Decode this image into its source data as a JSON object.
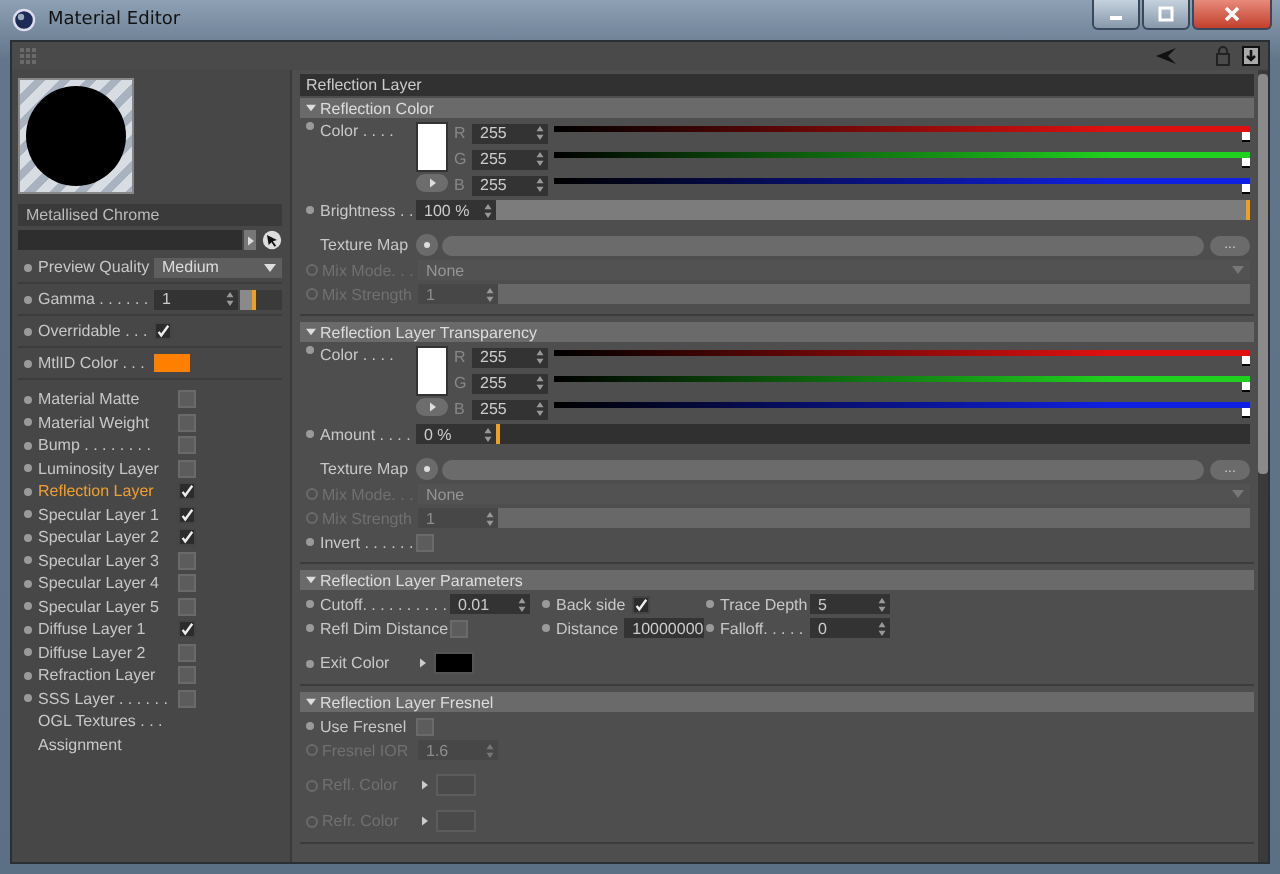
{
  "window": {
    "title": "Material Editor"
  },
  "material": {
    "name": "Metallised Chrome"
  },
  "settings": [
    {
      "kind": "dropdown",
      "label": "Preview Quality",
      "value": "Medium"
    },
    {
      "kind": "number",
      "label": "Gamma . . . . . .",
      "value": "1",
      "level": 0.4
    },
    {
      "kind": "checkbox",
      "label": "Overridable . . .",
      "checked": true
    },
    {
      "kind": "swatch",
      "label": "MtlID Color . . .",
      "color": "#ff8000"
    }
  ],
  "channels": [
    {
      "kind": "checkbox",
      "label": "Material Matte",
      "checked": false,
      "selected": false
    },
    {
      "kind": "checkbox",
      "label": "Material Weight",
      "checked": false,
      "selected": false
    },
    {
      "kind": "checkbox",
      "label": "Bump . . . . . . . .",
      "checked": false,
      "selected": false
    },
    {
      "kind": "checkbox",
      "label": "Luminosity Layer",
      "checked": false,
      "selected": false
    },
    {
      "kind": "checkbox",
      "label": "Reflection Layer",
      "checked": true,
      "selected": true
    },
    {
      "kind": "checkbox",
      "label": "Specular Layer 1",
      "checked": true,
      "selected": false
    },
    {
      "kind": "checkbox",
      "label": "Specular Layer 2",
      "checked": true,
      "selected": false
    },
    {
      "kind": "checkbox",
      "label": "Specular Layer 3",
      "checked": false,
      "selected": false
    },
    {
      "kind": "checkbox",
      "label": "Specular Layer 4",
      "checked": false,
      "selected": false
    },
    {
      "kind": "checkbox",
      "label": "Specular Layer 5",
      "checked": false,
      "selected": false
    },
    {
      "kind": "checkbox",
      "label": "Diffuse Layer 1",
      "checked": true,
      "selected": false
    },
    {
      "kind": "checkbox",
      "label": "Diffuse Layer 2",
      "checked": false,
      "selected": false
    },
    {
      "kind": "checkbox",
      "label": "Refraction Layer",
      "checked": false,
      "selected": false
    },
    {
      "kind": "checkbox",
      "label": "SSS Layer . . . . . .",
      "checked": false,
      "selected": false
    },
    {
      "kind": "link",
      "label": "OGL Textures . . .",
      "selected": false
    },
    {
      "kind": "link",
      "label": "Assignment",
      "selected": false
    }
  ],
  "panel": {
    "title": "Reflection Layer",
    "sections": [
      {
        "title": "Reflection Color",
        "expanded": true,
        "rows": [
          {
            "kind": "color",
            "label": "Color . . . .",
            "color": "#ffffff",
            "channels": [
              {
                "name": "R",
                "value": "255",
                "level": 1,
                "color": "#e01010"
              },
              {
                "name": "G",
                "value": "255",
                "level": 1,
                "color": "#20d020"
              },
              {
                "name": "B",
                "value": "255",
                "level": 1,
                "color": "#1020e0"
              }
            ]
          },
          {
            "kind": "slider",
            "label": "Brightness . .",
            "value": "100 %",
            "level": 1,
            "disabled": false
          },
          {
            "kind": "texture",
            "label": "Texture Map",
            "button": "..."
          },
          {
            "kind": "dropdown",
            "label": "Mix Mode. . .",
            "value": "None",
            "disabled": true
          },
          {
            "kind": "slider",
            "label": "Mix Strength",
            "value": "1",
            "disabled": true
          }
        ]
      },
      {
        "title": "Reflection Layer Transparency",
        "expanded": true,
        "rows": [
          {
            "kind": "color",
            "label": "Color . . . .",
            "color": "#ffffff",
            "channels": [
              {
                "name": "R",
                "value": "255",
                "level": 1,
                "color": "#e01010"
              },
              {
                "name": "G",
                "value": "255",
                "level": 1,
                "color": "#20d020"
              },
              {
                "name": "B",
                "value": "255",
                "level": 1,
                "color": "#1020e0"
              }
            ]
          },
          {
            "kind": "slider",
            "label": "Amount . . . .",
            "value": "0 %",
            "level": 0,
            "disabled": false
          },
          {
            "kind": "texture",
            "label": "Texture Map",
            "button": "..."
          },
          {
            "kind": "dropdown",
            "label": "Mix Mode. . .",
            "value": "None",
            "disabled": true
          },
          {
            "kind": "slider",
            "label": "Mix Strength",
            "value": "1",
            "disabled": true
          },
          {
            "kind": "checkbox",
            "label": "Invert . . . . . .",
            "checked": false,
            "disabled": false
          }
        ]
      },
      {
        "title": "Reflection Layer Parameters",
        "expanded": true,
        "rows": [
          {
            "kind": "fields",
            "items": [
              {
                "kind": "number",
                "label": "Cutoff. . . . . . . . . .",
                "value": "0.01"
              },
              {
                "kind": "checkbox",
                "label": "Back side",
                "checked": true
              },
              {
                "kind": "number",
                "label": "Trace Depth",
                "value": "5"
              }
            ]
          },
          {
            "kind": "fields",
            "items": [
              {
                "kind": "checkbox",
                "label": "Refl Dim Distance",
                "checked": false
              },
              {
                "kind": "number",
                "label": "Distance",
                "value": "10000000"
              },
              {
                "kind": "number",
                "label": "Falloff. . . . .",
                "value": "0"
              }
            ]
          },
          {
            "kind": "swatch",
            "label": "Exit Color",
            "color": "#000000",
            "disabled": false
          }
        ]
      },
      {
        "title": "Reflection Layer Fresnel",
        "expanded": true,
        "rows": [
          {
            "kind": "checkbox",
            "label": "Use Fresnel",
            "checked": false,
            "disabled": false
          },
          {
            "kind": "number",
            "label": "Fresnel IOR",
            "value": "1.6",
            "disabled": true
          },
          {
            "kind": "swatch",
            "label": "Refl. Color",
            "disabled": true
          },
          {
            "kind": "swatch",
            "label": "Refr. Color",
            "disabled": true
          }
        ]
      }
    ]
  }
}
